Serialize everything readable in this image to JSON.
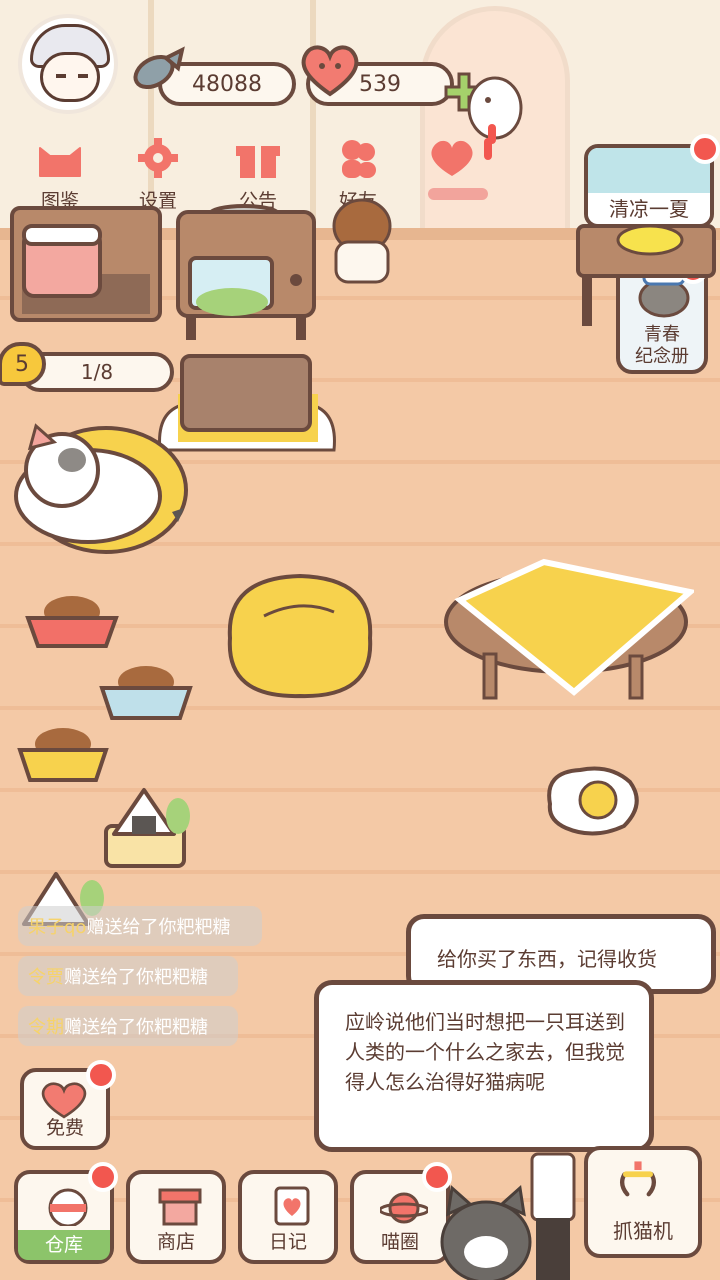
{
  "header": {
    "fish_coins": "48088",
    "hearts": "539"
  },
  "menu": [
    {
      "label": "图鉴",
      "icon": "cat-head-icon"
    },
    {
      "label": "设置",
      "icon": "gear-icon"
    },
    {
      "label": "公告",
      "icon": "gift-icon"
    },
    {
      "label": "好友",
      "icon": "friends-icon"
    }
  ],
  "events": {
    "summer_label": "清凉一夏",
    "memorial_label_1": "青春",
    "memorial_label_2": "纪念册"
  },
  "level": {
    "number": "5",
    "progress": "1/8"
  },
  "gift_messages": [
    {
      "name": "果子qo",
      "text": "赠送给了你粑粑糖"
    },
    {
      "name": "令贾",
      "text": "赠送给了你粑粑糖"
    },
    {
      "name": "令期",
      "text": "赠送给了你粑粑糖"
    }
  ],
  "dialogs": {
    "bubble_1": "给你买了东西，记得收货",
    "bubble_2": "应岭说他们当时想把一只耳送到人类的一个什么之家去，但我觉得人怎么治得好猫病呢"
  },
  "free_button": {
    "label": "免费"
  },
  "nav": [
    {
      "label": "仓库",
      "active": true
    },
    {
      "label": "商店"
    },
    {
      "label": "日记"
    },
    {
      "label": "喵圈"
    }
  ],
  "claw_machine": {
    "label": "抓猫机"
  },
  "colors": {
    "outline": "#6b4a3e",
    "floor": "#f4c9a6",
    "wall": "#f8eedf",
    "badge_red": "#f2574f",
    "active_green": "#8cc46a",
    "yellow": "#f7c83c"
  }
}
